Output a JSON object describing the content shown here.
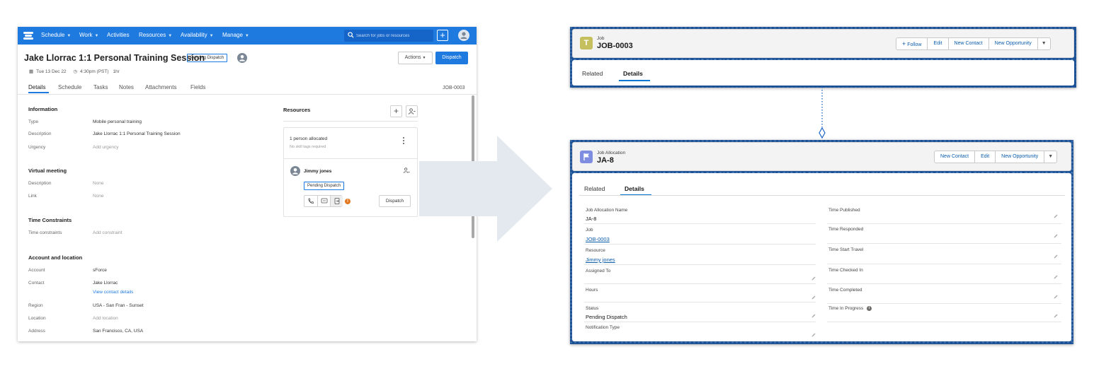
{
  "left_app": {
    "nav": {
      "items": [
        {
          "label": "Schedule",
          "dropdown": true
        },
        {
          "label": "Work",
          "dropdown": true
        },
        {
          "label": "Activities",
          "dropdown": false
        },
        {
          "label": "Resources",
          "dropdown": true
        },
        {
          "label": "Availability",
          "dropdown": true
        },
        {
          "label": "Manage",
          "dropdown": true
        }
      ],
      "search_placeholder": "Search for jobs or resources",
      "plus_icon": "plus-icon",
      "avatar_icon": "user-avatar-icon",
      "bar_color": "#1f7ae0"
    },
    "job": {
      "title": "Jake Llorrac 1:1 Personal Training Session",
      "status": "Pending Dispatch",
      "date": "Tue 13 Dec 22",
      "time": "4:30pm (PST)",
      "duration": "1hr",
      "actions_label": "Actions",
      "dispatch_label": "Dispatch",
      "id": "JOB-0003"
    },
    "tabs": [
      "Details",
      "Schedule",
      "Tasks",
      "Notes",
      "Attachments",
      "Fields"
    ],
    "information": {
      "heading": "Information",
      "type_label": "Type",
      "type_value": "Mobile personal training",
      "description_label": "Description",
      "description_value": "Jake Llorrac 1:1 Personal Training Session",
      "urgency_label": "Urgency",
      "urgency_value": "Add urgency"
    },
    "virtual_meeting": {
      "heading": "Virtual meeting",
      "description_label": "Description",
      "description_value": "None",
      "link_label": "Link",
      "link_value": "None"
    },
    "time_constraints": {
      "heading": "Time Constraints",
      "label": "Time constraints",
      "value": "Add constraint"
    },
    "account_location": {
      "heading": "Account and location",
      "account_label": "Account",
      "account_value": "sForce",
      "contact_label": "Contact",
      "contact_value": "Jake Llorrac",
      "contact_link": "View contact details",
      "region_label": "Region",
      "region_value": "USA - San Fran - Sunset",
      "location_label": "Location",
      "location_value": "Add location",
      "address_label": "Address",
      "address_value": "San Francisco, CA, USA"
    },
    "resources": {
      "heading": "Resources",
      "allocated": "1 person allocated",
      "skills": "No skill tags required",
      "person_name": "Jimmy jones",
      "person_status": "Pending Dispatch",
      "dispatch_label": "Dispatch",
      "warning_glyph": "!"
    }
  },
  "job_panel": {
    "object_type": "Job",
    "record_name": "JOB-0003",
    "icon_color": "#c5c05d",
    "icon_glyph": "T",
    "buttons": [
      {
        "label": "Follow",
        "icon": "plus-icon"
      },
      {
        "label": "Edit"
      },
      {
        "label": "New Contact"
      },
      {
        "label": "New Opportunity"
      }
    ],
    "dropdown_glyph": "▼",
    "tabs": [
      "Related",
      "Details"
    ]
  },
  "allocation_panel": {
    "object_type": "Job Allocation",
    "record_name": "JA-8",
    "icon_color": "#7f8de1",
    "buttons": [
      {
        "label": "New Contact"
      },
      {
        "label": "Edit"
      },
      {
        "label": "New Opportunity"
      }
    ],
    "dropdown_glyph": "▼",
    "tabs": [
      "Related",
      "Details"
    ],
    "left_fields": [
      {
        "label": "Job Allocation Name",
        "value": "JA-8",
        "link": false
      },
      {
        "label": "Job",
        "value": "JOB-0003",
        "link": true
      },
      {
        "label": "Resource",
        "value": "Jimmy jones",
        "link": true
      },
      {
        "label": "Assigned To",
        "value": "",
        "link": false
      },
      {
        "label": "Hours",
        "value": "",
        "link": false
      },
      {
        "label": "Status",
        "value": "Pending Dispatch",
        "link": false
      },
      {
        "label": "Notification Type",
        "value": "",
        "link": false
      }
    ],
    "right_fields": [
      {
        "label": "Time Published",
        "value": ""
      },
      {
        "label": "Time Responded",
        "value": ""
      },
      {
        "label": "Time Start Travel",
        "value": ""
      },
      {
        "label": "Time Checked In",
        "value": ""
      },
      {
        "label": "Time Completed",
        "value": ""
      },
      {
        "label": "Time In Progress",
        "value": "",
        "info": true
      }
    ]
  },
  "colors": {
    "accent": "#1f7ae0",
    "salesforce_blue": "#0176d3",
    "panel_background": "#1b5297",
    "arrow": "#e3e9ee"
  }
}
